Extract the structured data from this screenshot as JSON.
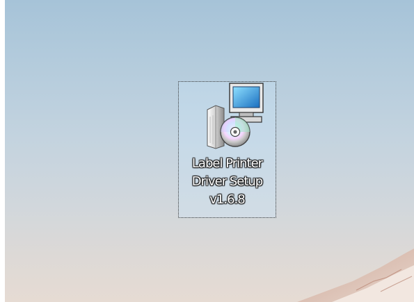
{
  "desktop": {
    "icons": [
      {
        "label_lines": [
          "Label Printer",
          "Driver Setup",
          "v1.6.8"
        ],
        "icon": "installer-setup-icon",
        "selected": true
      }
    ]
  }
}
